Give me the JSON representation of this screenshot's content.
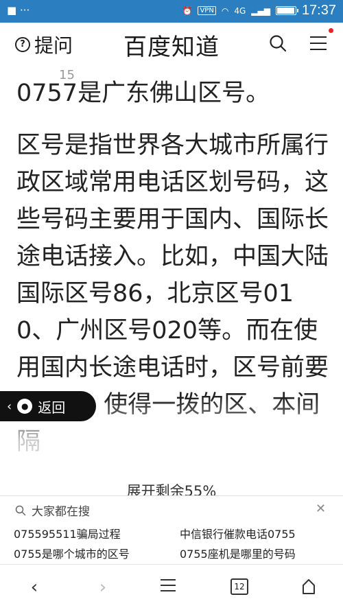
{
  "status_bar": {
    "left_icons": [
      "dot-icon",
      "menu-dots-icon"
    ],
    "vpn": "VPN",
    "network": "4G",
    "time": "17:37",
    "battery_level": 0.9
  },
  "header": {
    "ask_label": "提问",
    "brand": "百度知道"
  },
  "article": {
    "page_number": "15",
    "paragraph_1": "0757是广东佛山区号。",
    "paragraph_2": "区号是指世界各大城市所属行政区域常用电话区划号码，这些号码主要用于国内、国际长途电话接入。比如，中国大陆国际区号86，北京区号010、广州区号020等。而在使用国内长途电话时，区号前要加拨0，使得一拨的区、本间隔",
    "expand_label": "展开剩余55%"
  },
  "back_button": {
    "label": "返回"
  },
  "suggestions": {
    "title": "大家都在搜",
    "items": [
      "075595511骗局过程",
      "中信银行催款电话0755",
      "0755是哪个城市的区号",
      "0755座机是哪里的号码"
    ]
  },
  "bottom_nav": {
    "tab_count": "12"
  },
  "colors": {
    "status_bar": "#2b7fc0",
    "notification_dot": "#e22222"
  }
}
